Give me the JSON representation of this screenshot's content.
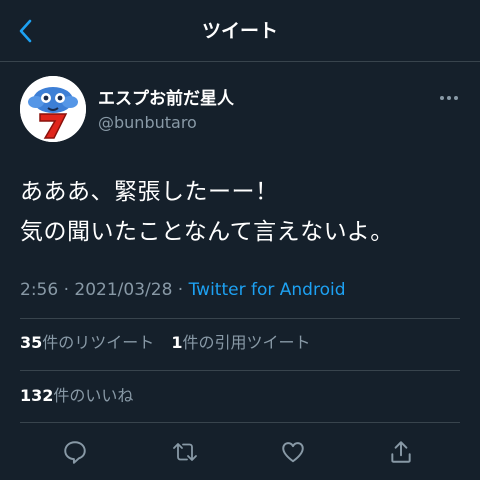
{
  "header": {
    "title": "ツイート",
    "back_icon": "chevron-left-icon",
    "accent": "#1da1f2"
  },
  "author": {
    "name": "エスプお前だ星人",
    "handle": "@bunbutaro",
    "avatar_icon": "blue-alien-slot-seven-avatar"
  },
  "tweet": {
    "lines": [
      "あああ、緊張したーー！",
      "気の聞いたことなんて言えないよ。"
    ],
    "time": "2:56",
    "separator": "·",
    "date": "2021/03/28",
    "source": "Twitter for Android"
  },
  "stats": {
    "retweets_count": "35",
    "retweets_label": "件のリツイート",
    "quotes_count": "1",
    "quotes_label": "件の引用ツイート",
    "likes_count": "132",
    "likes_label": "件のいいね"
  },
  "actions": [
    "reply-icon",
    "retweet-icon",
    "like-icon",
    "share-icon"
  ],
  "colors": {
    "background": "#15202b",
    "muted": "#8899a6",
    "divider": "#38444d"
  }
}
